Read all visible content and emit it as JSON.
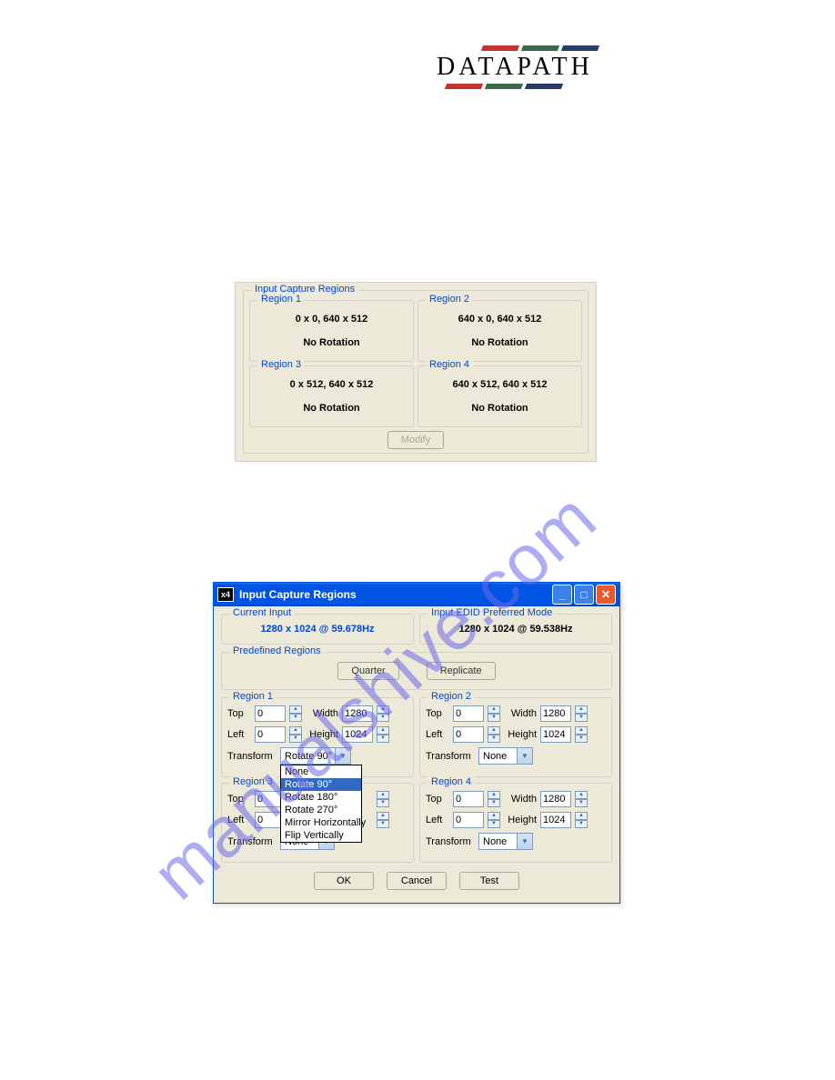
{
  "logo": {
    "text": "DATAPATH",
    "bar_colors": [
      "#c4342c",
      "#3a6a4a",
      "#2a3a6a"
    ]
  },
  "watermark": "manualshive.com",
  "panel1": {
    "title": "Input Capture Regions",
    "regions": [
      {
        "title": "Region 1",
        "coords": "0 x 0, 640 x 512",
        "rotation": "No Rotation"
      },
      {
        "title": "Region 2",
        "coords": "640 x 0, 640 x 512",
        "rotation": "No Rotation"
      },
      {
        "title": "Region 3",
        "coords": "0 x 512, 640 x 512",
        "rotation": "No Rotation"
      },
      {
        "title": "Region 4",
        "coords": "640 x 512, 640 x 512",
        "rotation": "No Rotation"
      }
    ],
    "modify_label": "Modify"
  },
  "dialog": {
    "title": "Input Capture Regions",
    "icon_text": "x4",
    "current_input": {
      "title": "Current Input",
      "value": "1280 x 1024 @ 59.678Hz"
    },
    "edid": {
      "title": "Input EDID Preferred Mode",
      "value": "1280 x 1024 @ 59.538Hz"
    },
    "predefined": {
      "title": "Predefined Regions",
      "quarter": "Quarter",
      "replicate": "Replicate"
    },
    "labels": {
      "top": "Top",
      "left": "Left",
      "width": "Width",
      "height": "Height",
      "transform": "Transform"
    },
    "regions": [
      {
        "title": "Region 1",
        "top": "0",
        "left": "0",
        "width": "1280",
        "height": "1024",
        "transform": "Rotate 90°",
        "dropdown_open": true
      },
      {
        "title": "Region 2",
        "top": "0",
        "left": "0",
        "width": "1280",
        "height": "1024",
        "transform": "None",
        "dropdown_open": false
      },
      {
        "title": "Region 3",
        "top": "0",
        "left": "0",
        "width": "",
        "height": "",
        "transform": "None",
        "dropdown_open": false
      },
      {
        "title": "Region 4",
        "top": "0",
        "left": "0",
        "width": "1280",
        "height": "1024",
        "transform": "None",
        "dropdown_open": false
      }
    ],
    "transform_options": [
      "None",
      "Rotate 90°",
      "Rotate 180°",
      "Rotate 270°",
      "Mirror Horizontally",
      "Flip Vertically"
    ],
    "transform_selected": "Rotate 90°",
    "buttons": {
      "ok": "OK",
      "cancel": "Cancel",
      "test": "Test"
    }
  }
}
